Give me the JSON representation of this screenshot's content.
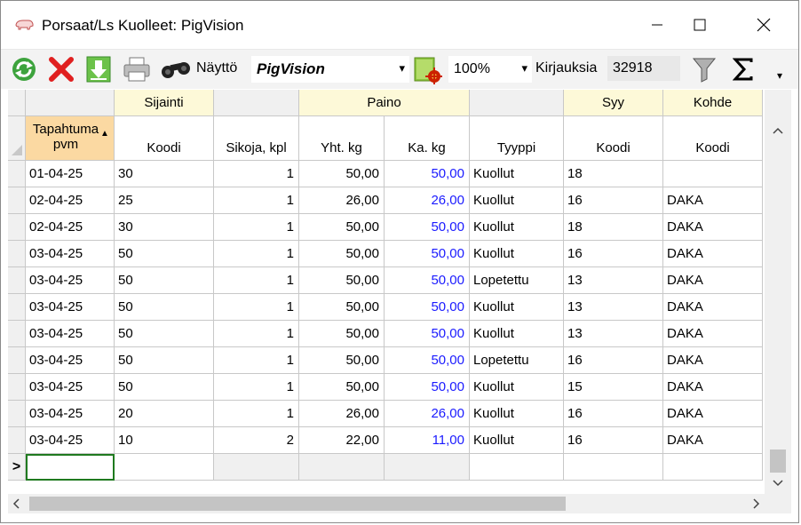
{
  "window": {
    "title": "Porsaat/Ls Kuolleet: PigVision",
    "minimize_glyph": "—",
    "maximize_glyph": "☐",
    "close_glyph": "✕"
  },
  "toolbar": {
    "refresh_icon": "refresh-icon",
    "delete_icon": "delete-icon",
    "download_icon": "download-icon",
    "print_icon": "print-icon",
    "binoculars_icon": "binoculars-icon",
    "display_label": "Näyttö",
    "display_value": "PigVision",
    "report_icon": "report-settings-icon",
    "zoom_value": "100%",
    "records_label": "Kirjauksia",
    "records_count": "32918",
    "filter_icon": "filter-icon",
    "sum_icon": "sum-icon",
    "dropdown_arrow": "▾",
    "overflow_arrow": "▾"
  },
  "grid": {
    "group_headers": [
      "",
      "Sijainti",
      "",
      "Paino",
      "",
      "Syy",
      "Kohde"
    ],
    "column_headers": [
      "Tapahtuma pvm",
      "Koodi",
      "Sikoja, kpl",
      "Yht. kg",
      "Ka. kg",
      "Tyyppi",
      "Koodi",
      "Koodi"
    ],
    "sort_indicator": "▲",
    "new_row_marker": ">",
    "rows": [
      [
        "01-04-25",
        "30",
        "1",
        "50,00",
        "50,00",
        "Kuollut",
        "18",
        ""
      ],
      [
        "02-04-25",
        "25",
        "1",
        "26,00",
        "26,00",
        "Kuollut",
        "16",
        "DAKA"
      ],
      [
        "02-04-25",
        "30",
        "1",
        "50,00",
        "50,00",
        "Kuollut",
        "18",
        "DAKA"
      ],
      [
        "03-04-25",
        "50",
        "1",
        "50,00",
        "50,00",
        "Kuollut",
        "16",
        "DAKA"
      ],
      [
        "03-04-25",
        "50",
        "1",
        "50,00",
        "50,00",
        "Lopetettu",
        "13",
        "DAKA"
      ],
      [
        "03-04-25",
        "50",
        "1",
        "50,00",
        "50,00",
        "Kuollut",
        "13",
        "DAKA"
      ],
      [
        "03-04-25",
        "50",
        "1",
        "50,00",
        "50,00",
        "Kuollut",
        "13",
        "DAKA"
      ],
      [
        "03-04-25",
        "50",
        "1",
        "50,00",
        "50,00",
        "Lopetettu",
        "16",
        "DAKA"
      ],
      [
        "03-04-25",
        "50",
        "1",
        "50,00",
        "50,00",
        "Kuollut",
        "15",
        "DAKA"
      ],
      [
        "03-04-25",
        "20",
        "1",
        "26,00",
        "26,00",
        "Kuollut",
        "16",
        "DAKA"
      ],
      [
        "03-04-25",
        "10",
        "2",
        "22,00",
        "11,00",
        "Kuollut",
        "16",
        "DAKA"
      ]
    ]
  },
  "scroll": {
    "up_arrow": "^",
    "down_arrow": "v",
    "left_arrow": "<",
    "right_arrow": ">"
  },
  "colors": {
    "header_yellow": "#fdf9d8",
    "header_orange": "#fbd9a2",
    "avg_blue": "#1a1aff",
    "selection_green": "#1f7a1f"
  }
}
